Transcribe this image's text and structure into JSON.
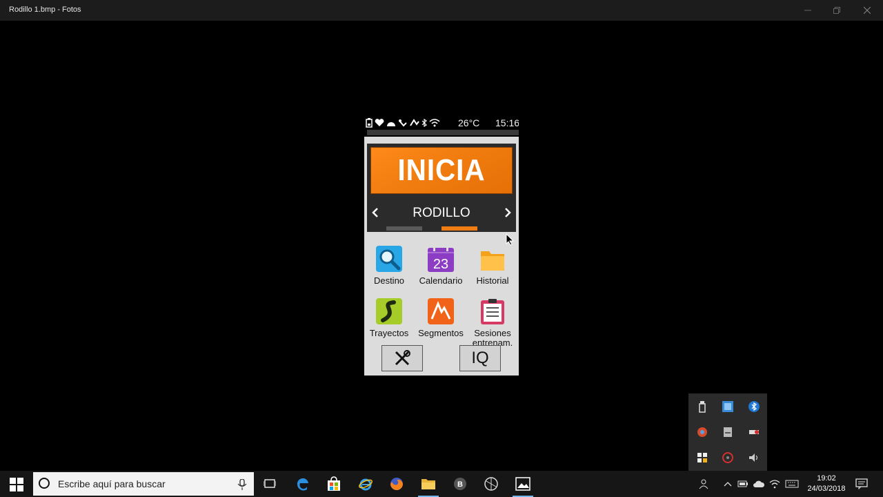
{
  "window": {
    "title": "Rodillo 1.bmp - Fotos"
  },
  "device": {
    "status": {
      "temperature": "26°C",
      "time": "15:16"
    },
    "start_button": {
      "label": "INICIA"
    },
    "profile": {
      "name": "RODILLO",
      "prev_symbol": "‹",
      "next_symbol": "›"
    },
    "apps": [
      {
        "label": "Destino",
        "icon": "search-icon"
      },
      {
        "label": "Calendario",
        "icon": "calendar-icon",
        "day": "23"
      },
      {
        "label": "Historial",
        "icon": "folder-icon"
      },
      {
        "label": "Trayectos",
        "icon": "route-icon"
      },
      {
        "label": "Segmentos",
        "icon": "segments-icon"
      },
      {
        "label": "Sesiones entrenam.",
        "icon": "clipboard-icon"
      }
    ],
    "bottom_buttons": {
      "settings_icon": "tools-icon",
      "iq_label": "IQ"
    }
  },
  "taskbar": {
    "search_placeholder": "Escribe aquí para buscar",
    "time": "19:02",
    "date": "24/03/2018"
  },
  "colors": {
    "accent_orange": "#f07c13",
    "device_bg": "#dcdcdc",
    "taskbar_bg": "#161616"
  }
}
